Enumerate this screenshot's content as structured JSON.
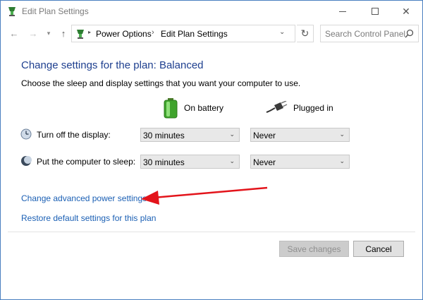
{
  "window": {
    "title": "Edit Plan Settings"
  },
  "nav": {
    "breadcrumbs": [
      "Power Options",
      "Edit Plan Settings"
    ],
    "search_placeholder": "Search Control Panel"
  },
  "main": {
    "heading": "Change settings for the plan: Balanced",
    "subtext": "Choose the sleep and display settings that you want your computer to use.",
    "columns": {
      "battery": "On battery",
      "plugged": "Plugged in"
    },
    "rows": [
      {
        "label": "Turn off the display:",
        "battery": "30 minutes",
        "plugged": "Never"
      },
      {
        "label": "Put the computer to sleep:",
        "battery": "30 minutes",
        "plugged": "Never"
      }
    ],
    "links": {
      "advanced": "Change advanced power settings",
      "restore": "Restore default settings for this plan"
    }
  },
  "buttons": {
    "save": "Save changes",
    "cancel": "Cancel"
  },
  "colors": {
    "heading": "#1e3f8f",
    "link": "#1a5fb4",
    "annotation_arrow": "#e3141b"
  }
}
